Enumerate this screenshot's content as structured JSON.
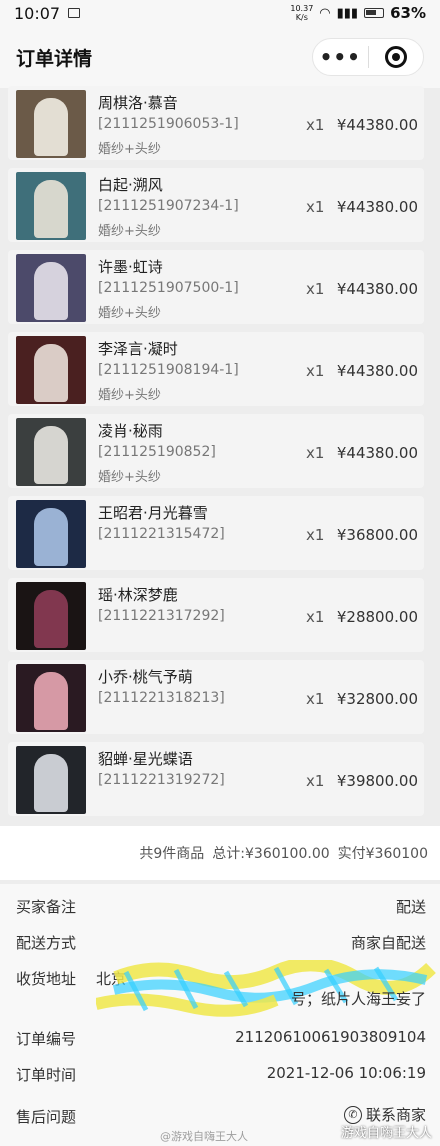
{
  "status": {
    "time": "10:07",
    "speed": "10.37\nK/s",
    "battery": "63%"
  },
  "navbar": {
    "title": "订单详情",
    "more": "•••"
  },
  "items": [
    {
      "name": "周棋洛·慕音",
      "code": "[2111251906053-1]",
      "spec": "婚纱+头纱",
      "qty": "x1",
      "price": "¥44380.00",
      "bg": "#6b5a48",
      "dress": "#f1ece2"
    },
    {
      "name": "白起·溯风",
      "code": "[2111251907234-1]",
      "spec": "婚纱+头纱",
      "qty": "x1",
      "price": "¥44380.00",
      "bg": "#3f6f7a",
      "dress": "#e8e2d6"
    },
    {
      "name": "许墨·虹诗",
      "code": "[2111251907500-1]",
      "spec": "婚纱+头纱",
      "qty": "x1",
      "price": "¥44380.00",
      "bg": "#4c4a6a",
      "dress": "#e6e1ea"
    },
    {
      "name": "李泽言·凝时",
      "code": "[2111251908194-1]",
      "spec": "婚纱+头纱",
      "qty": "x1",
      "price": "¥44380.00",
      "bg": "#4a2020",
      "dress": "#eadfd8"
    },
    {
      "name": "凌肖·秘雨",
      "code": "[211125190852]",
      "spec": "婚纱+头纱",
      "qty": "x1",
      "price": "¥44380.00",
      "bg": "#3b3f3f",
      "dress": "#e8e6e0"
    },
    {
      "name": "王昭君·月光暮雪",
      "code": "[2111221315472]",
      "spec": "",
      "qty": "x1",
      "price": "¥36800.00",
      "bg": "#1d2a45",
      "dress": "#a9c1e3"
    },
    {
      "name": "瑶·林深梦鹿",
      "code": "[2111221317292]",
      "spec": "",
      "qty": "x1",
      "price": "¥28800.00",
      "bg": "#1a1414",
      "dress": "#8d3b55"
    },
    {
      "name": "小乔·桃气予萌",
      "code": "[2111221318213]",
      "spec": "",
      "qty": "x1",
      "price": "¥32800.00",
      "bg": "#2a1a22",
      "dress": "#e9a7b4"
    },
    {
      "name": "貂蝉·星光蝶语",
      "code": "[2111221319272]",
      "spec": "",
      "qty": "x1",
      "price": "¥39800.00",
      "bg": "#22252a",
      "dress": "#dcdfe4"
    }
  ],
  "summary": {
    "count": "共9件商品",
    "total": "总计:¥360100.00",
    "paid": "实付¥360100"
  },
  "details": {
    "remark_label": "买家备注",
    "remark_value": "配送",
    "delivery_label": "配送方式",
    "delivery_value": "商家自配送",
    "address_label": "收货地址",
    "address_start": "北京",
    "address_tail": "号；纸片人海王妄了",
    "order_no_label": "订单编号",
    "order_no_value": "2112061006190380910​4",
    "order_time_label": "订单时间",
    "order_time_value": "2021-12-06 10:06:19",
    "aftersale_label": "售后问题",
    "contact_label": "联系商家"
  },
  "watermarks": {
    "weibo": "@游戏自嗨王大人",
    "corner": "游戏自嗨王大人"
  },
  "colors": {
    "accent_scribble": "#f0e84a",
    "scribble_blue": "#35d0ff"
  }
}
